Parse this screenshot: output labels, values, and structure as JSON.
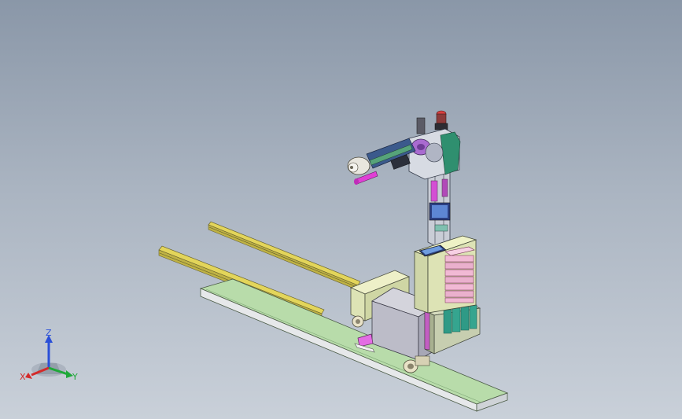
{
  "triad": {
    "z_label": "Z",
    "x_label": "X",
    "y_label": "Y",
    "colors": {
      "z": "#2a4fd8",
      "x": "#d42a2a",
      "y": "#1fa83a"
    }
  },
  "colors": {
    "background_top": "#8a97a8",
    "background_bottom": "#c9d0d9",
    "base_rail": "#b8dcaa",
    "guide_rail": "#e3d55a",
    "tower_body": "#dde3b5",
    "pink_stack": "#f1b9d4",
    "teal_bins": "#2f9a86",
    "magenta_parts": "#d64bd6"
  },
  "icons": {
    "triad": "coordinate-triad-icon"
  }
}
